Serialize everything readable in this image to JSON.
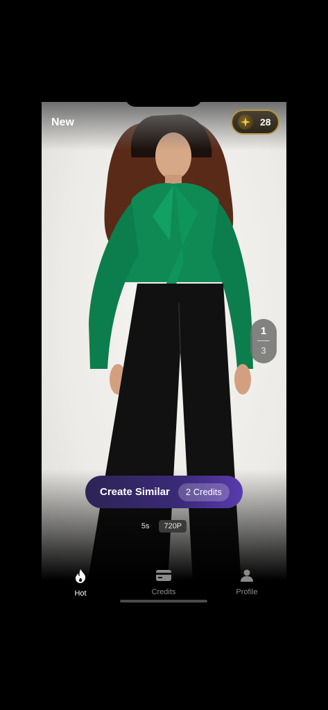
{
  "header": {
    "new_label": "New",
    "credits_balance": "28"
  },
  "pager": {
    "current": "1",
    "total": "3"
  },
  "action": {
    "create_label": "Create Similar",
    "cost_label": "2 Credits"
  },
  "meta": {
    "duration": "5s",
    "resolution": "720P"
  },
  "tabs": [
    {
      "label": "Hot",
      "icon": "flame-icon",
      "active": true
    },
    {
      "label": "Credits",
      "icon": "card-icon",
      "active": false
    },
    {
      "label": "Profile",
      "icon": "person-icon",
      "active": false
    }
  ],
  "colors": {
    "accent_gold": "#b59742",
    "button_purple": "#3a2a78",
    "blouse_green": "#0f8a55"
  }
}
